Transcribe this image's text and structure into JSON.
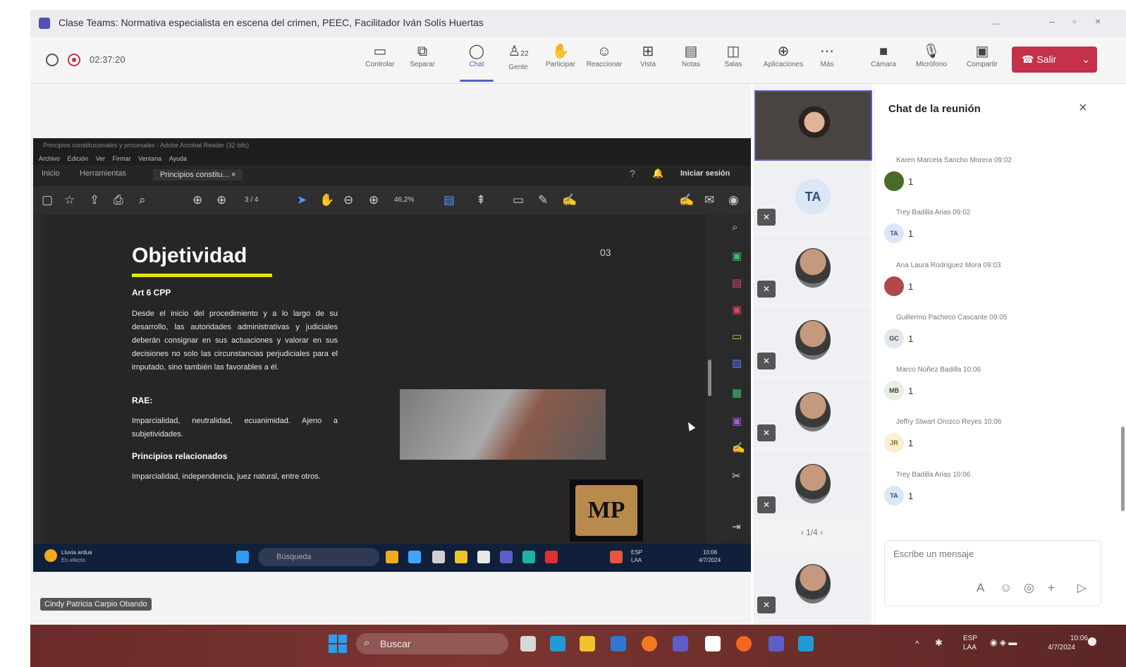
{
  "window": {
    "title": "Clase Teams: Normativa especialista en escena del crimen, PEEC, Facilitador Iván Solís Huertas",
    "controls": [
      "...",
      "–",
      "▫",
      "×"
    ]
  },
  "toolbar": {
    "timer": "02:37:20",
    "buttons": [
      {
        "label": "Controlar",
        "icon": "control-icon"
      },
      {
        "label": "Separar",
        "icon": "popout-icon"
      },
      {
        "label": "Chat",
        "icon": "chat-icon"
      },
      {
        "label": "Gente",
        "icon": "people-icon",
        "badge": "22"
      },
      {
        "label": "Participar",
        "icon": "raise-hand-icon"
      },
      {
        "label": "Reaccionar",
        "icon": "smile-icon"
      },
      {
        "label": "Vista",
        "icon": "view-icon"
      },
      {
        "label": "Notas",
        "icon": "notes-icon"
      },
      {
        "label": "Salas",
        "icon": "rooms-icon"
      },
      {
        "label": "Aplicaciones",
        "icon": "apps-icon"
      },
      {
        "label": "Más",
        "icon": "more-icon"
      },
      {
        "label": "Cámara",
        "icon": "camera-off-icon"
      },
      {
        "label": "Micrófono",
        "icon": "mic-off-icon"
      },
      {
        "label": "Compartir",
        "icon": "share-icon"
      }
    ],
    "leave_label": "Salir",
    "active": "Chat"
  },
  "acrobat": {
    "window_title": "Principios constitucionales y procesales - Adobe Acrobat Reader (32 bits)",
    "menu": [
      "Archivo",
      "Edición",
      "Ver",
      "Firmar",
      "Ventana",
      "Ayuda"
    ],
    "tabs": [
      "Inicio",
      "Herramientas",
      "Principios constitu... ×"
    ],
    "signin": "Iniciar sesión",
    "page_indicator": "3 / 4",
    "zoom": "46,2%"
  },
  "slide": {
    "title": "Objetividad",
    "number": "03",
    "subtitle": "Art 6 CPP",
    "paragraph": "Desde el inicio del procedimiento y a lo largo de su desarrollo, las autoridades administrativas y judiciales deberán consignar en sus actuaciones y valorar en sus decisiones no solo las circunstancias perjudiciales para el imputado, sino también las favorables a él.",
    "rae_heading": "RAE:",
    "rae_text": "Imparcialidad, neutralidad, ecuanimidad. Ajeno a subjetividades.",
    "related_heading": "Principios relacionados",
    "related_text": "Imparcialidad, independencia, juez natural, entre otros.",
    "logo_text": "MP"
  },
  "inner_taskbar": {
    "weather": "Lluvia ardua",
    "weather_sub": "En efecto",
    "search": "Búsqueda",
    "lang": "ESP",
    "lang_sub": "LAA",
    "time": "10:06",
    "date": "4/7/2024"
  },
  "speaker_label": "Cindy Patricia Carpio Obando",
  "gallery": {
    "initials": "TA",
    "pager": "1/4"
  },
  "chat": {
    "title": "Chat de la reunión",
    "messages": [
      {
        "author": "Karen Marcela Sancho Morera",
        "time": "09:02",
        "avatar": "",
        "text": "1"
      },
      {
        "author": "Trey Badilla Arias",
        "time": "09:02",
        "avatar": "TA",
        "text": "1"
      },
      {
        "author": "Ana Laura Rodríguez Mora",
        "time": "09:03",
        "avatar": "",
        "text": "1"
      },
      {
        "author": "Guillermo Pacheco Cascante",
        "time": "09:05",
        "avatar": "GC",
        "text": "1"
      },
      {
        "author": "Marco Núñez Badilla",
        "time": "10:06",
        "avatar": "MB",
        "text": "1"
      },
      {
        "author": "Jeffry Stwart Orozco Reyes",
        "time": "10:06",
        "avatar": "JR",
        "text": "1"
      },
      {
        "author": "Trey Badilla Arias",
        "time": "10:06",
        "avatar": "TA",
        "text": "1"
      }
    ],
    "placeholder": "Escribe un mensaje"
  },
  "windows_taskbar": {
    "search": "Buscar",
    "lang": "ESP",
    "lang_sub": "LAA",
    "time": "10:06",
    "date": "4/7/2024"
  }
}
